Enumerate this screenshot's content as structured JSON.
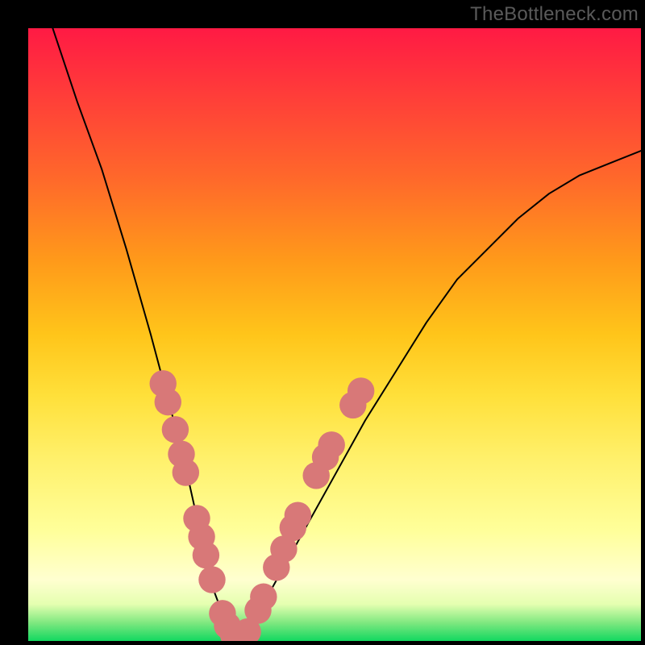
{
  "watermark": "TheBottleneck.com",
  "chart_data": {
    "type": "line",
    "title": "",
    "xlabel": "",
    "ylabel": "",
    "xlim": [
      0,
      100
    ],
    "ylim": [
      0,
      100
    ],
    "grid": false,
    "legend": false,
    "series": [
      {
        "name": "curve",
        "color": "#000000",
        "x": [
          4,
          8,
          12,
          16,
          20,
          24,
          26,
          28,
          30,
          33,
          36,
          40,
          45,
          50,
          55,
          60,
          65,
          70,
          75,
          80,
          85,
          90,
          95,
          100
        ],
        "y": [
          100,
          88,
          77,
          64,
          50,
          35,
          27,
          18,
          9,
          1,
          1,
          9,
          18,
          27,
          36,
          44,
          52,
          59,
          64,
          69,
          73,
          76,
          78,
          80
        ]
      }
    ],
    "markers": [
      {
        "name": "dots",
        "color": "#d87878",
        "radius": 2.2,
        "points": [
          {
            "x": 22.0,
            "y": 42.0
          },
          {
            "x": 22.8,
            "y": 39.0
          },
          {
            "x": 24.0,
            "y": 34.5
          },
          {
            "x": 25.0,
            "y": 30.5
          },
          {
            "x": 25.7,
            "y": 27.5
          },
          {
            "x": 27.5,
            "y": 20.0
          },
          {
            "x": 28.3,
            "y": 17.0
          },
          {
            "x": 29.0,
            "y": 14.0
          },
          {
            "x": 30.0,
            "y": 10.0
          },
          {
            "x": 31.7,
            "y": 4.5
          },
          {
            "x": 32.5,
            "y": 2.5
          },
          {
            "x": 33.5,
            "y": 1.0
          },
          {
            "x": 34.5,
            "y": 1.0
          },
          {
            "x": 35.8,
            "y": 1.5
          },
          {
            "x": 37.5,
            "y": 5.0
          },
          {
            "x": 38.4,
            "y": 7.2
          },
          {
            "x": 40.5,
            "y": 12.0
          },
          {
            "x": 41.7,
            "y": 15.0
          },
          {
            "x": 43.2,
            "y": 18.5
          },
          {
            "x": 44.0,
            "y": 20.5
          },
          {
            "x": 47.0,
            "y": 27.0
          },
          {
            "x": 48.5,
            "y": 30.0
          },
          {
            "x": 49.5,
            "y": 32.0
          },
          {
            "x": 53.0,
            "y": 38.5
          },
          {
            "x": 54.3,
            "y": 40.8
          }
        ]
      }
    ]
  }
}
